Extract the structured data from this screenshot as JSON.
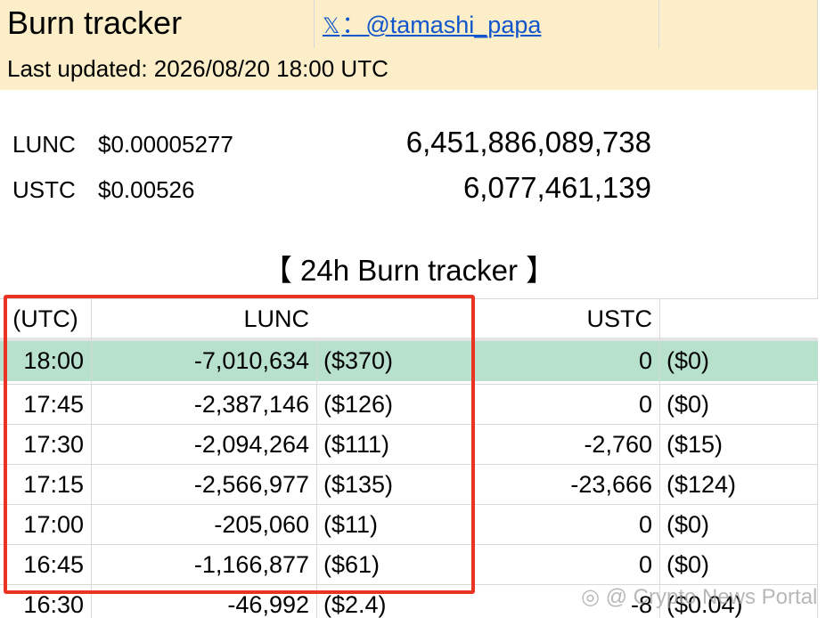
{
  "header": {
    "title": "Burn tracker",
    "social_icon": "𝕏",
    "social_handle": "：@tamashi_papa",
    "last_updated": "Last updated: 2026/08/20 18:00 UTC"
  },
  "prices": [
    {
      "symbol": "LUNC",
      "price": "$0.00005277",
      "supply": "6,451,886,089,738"
    },
    {
      "symbol": "USTC",
      "price": "$0.00526",
      "supply": "6,077,461,139"
    }
  ],
  "section_title": "【 24h Burn tracker 】",
  "table": {
    "headers": {
      "time": "(UTC)",
      "lunc": "LUNC",
      "ustc": "USTC"
    },
    "rows": [
      {
        "time": "18:00",
        "lunc": "-7,010,634",
        "lunc_usd": "($370)",
        "ustc": "0",
        "ustc_usd": "($0)"
      },
      {
        "time": "17:45",
        "lunc": "-2,387,146",
        "lunc_usd": "($126)",
        "ustc": "0",
        "ustc_usd": "($0)"
      },
      {
        "time": "17:30",
        "lunc": "-2,094,264",
        "lunc_usd": "($111)",
        "ustc": "-2,760",
        "ustc_usd": "($15)"
      },
      {
        "time": "17:15",
        "lunc": "-2,566,977",
        "lunc_usd": "($135)",
        "ustc": "-23,666",
        "ustc_usd": "($124)"
      },
      {
        "time": "17:00",
        "lunc": "-205,060",
        "lunc_usd": "($11)",
        "ustc": "0",
        "ustc_usd": "($0)"
      },
      {
        "time": "16:45",
        "lunc": "-1,166,877",
        "lunc_usd": "($61)",
        "ustc": "0",
        "ustc_usd": "($0)"
      },
      {
        "time": "16:30",
        "lunc": "-46,992",
        "lunc_usd": "($2.4)",
        "ustc": "-8",
        "ustc_usd": "($0.04)"
      }
    ]
  },
  "watermark": "◎ @ Crypto News Portal",
  "colors": {
    "header_bg": "#fbeec8",
    "highlight_row": "#b7e1cd",
    "link": "#1155cc",
    "annotation_box": "#ea3323",
    "gridline": "#d9d9d9"
  }
}
